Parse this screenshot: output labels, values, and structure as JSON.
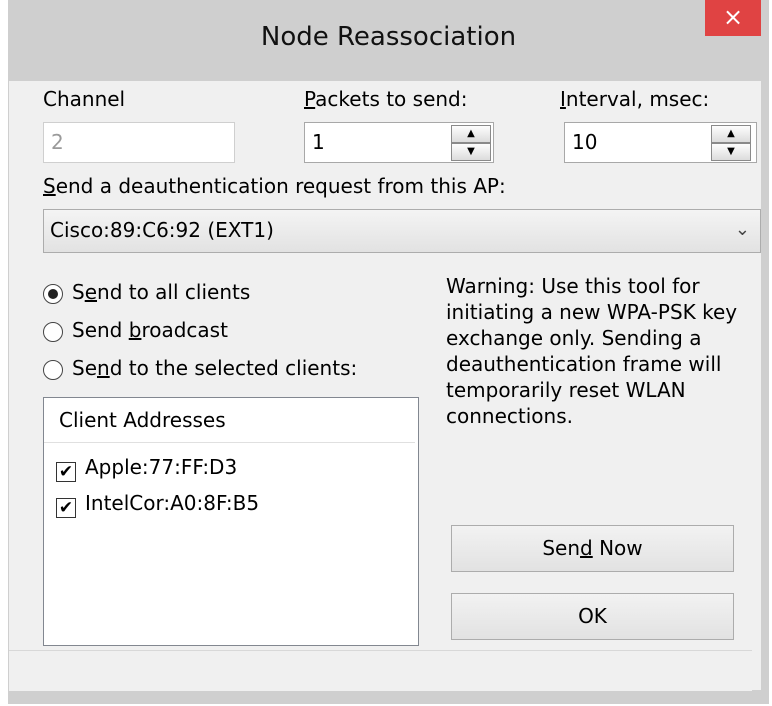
{
  "window": {
    "title": "Node Reassociation",
    "close_icon": "×"
  },
  "channel": {
    "label": "Channel",
    "value": "2"
  },
  "packets": {
    "label_ul": "P",
    "label_rest": "ackets to send:",
    "value": "1"
  },
  "interval": {
    "label_ul": "I",
    "label_rest": "nterval, msec:",
    "value": "10"
  },
  "ap": {
    "label_ul": "S",
    "label_rest": "end a deauthentication request from this AP:",
    "selected": "Cisco:89:C6:92 (EXT1)"
  },
  "send_options": {
    "all": {
      "pre": "S",
      "ul": "e",
      "post": "nd to all clients",
      "selected": true
    },
    "broadcast": {
      "pre": "Send ",
      "ul": "b",
      "post": "roadcast",
      "selected": false
    },
    "selected_clients": {
      "pre": "Se",
      "ul": "n",
      "post": "d to the selected clients:",
      "selected": false
    }
  },
  "clients": {
    "header": "Client Addresses",
    "items": [
      {
        "label": "Apple:77:FF:D3",
        "checked": true
      },
      {
        "label": "IntelCor:A0:8F:B5",
        "checked": true
      }
    ]
  },
  "warning": "Warning: Use this tool for initiating a new WPA-PSK key exchange only. Sending a deauthentication frame will temporarily reset WLAN connections.",
  "buttons": {
    "send_now": {
      "pre": "Sen",
      "ul": "d",
      "post": " Now"
    },
    "ok": "OK"
  }
}
